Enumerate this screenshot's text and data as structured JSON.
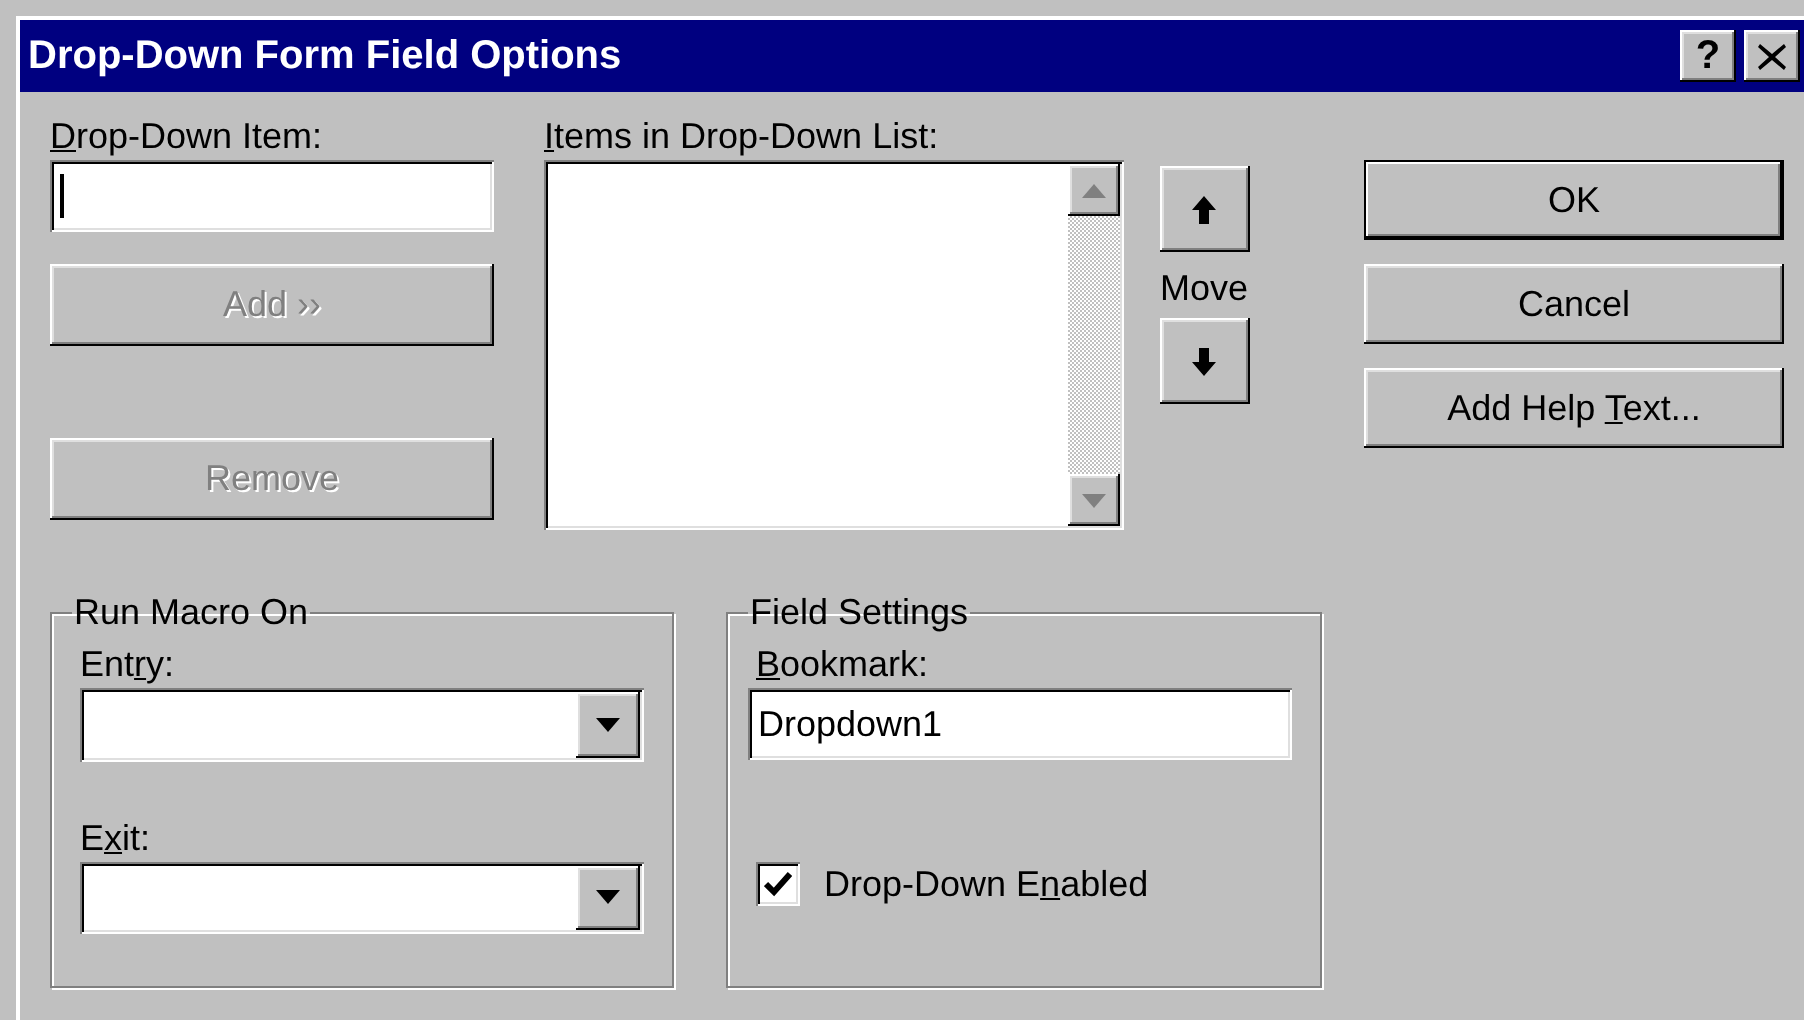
{
  "window": {
    "title": "Drop-Down Form Field Options",
    "help_button": "?"
  },
  "drop_down_item": {
    "label": {
      "key": "D",
      "post": "rop-Down Item:"
    },
    "focused": true
  },
  "add_button": {
    "label": {
      "pre": "Add ››"
    },
    "disabled": true
  },
  "remove_button": {
    "label": {
      "pre": "Remove"
    },
    "disabled": true
  },
  "list": {
    "label": {
      "key": "I",
      "post": "tems in Drop-Down List:"
    }
  },
  "move": {
    "label": "Move"
  },
  "buttons": [
    {
      "label": {
        "pre": "OK"
      },
      "default": true
    },
    {
      "label": {
        "pre": "Cancel"
      },
      "default": false
    },
    {
      "label": {
        "pre": "Add Help ",
        "key": "T",
        "post": "ext..."
      },
      "default": false
    }
  ],
  "run_macro": {
    "title": "Run Macro On",
    "entry": {
      "label": {
        "pre": "Ent",
        "key": "r",
        "post": "y:"
      }
    },
    "exit": {
      "label": {
        "pre": "E",
        "key": "x",
        "post": "it:"
      }
    }
  },
  "field_settings": {
    "title": "Field Settings",
    "bookmark": {
      "label": {
        "key": "B",
        "post": "ookmark:"
      },
      "value": "Dropdown1"
    },
    "enabled": {
      "label": {
        "pre": "Drop-Down E",
        "key": "n",
        "post": "abled"
      },
      "checked": true
    }
  }
}
